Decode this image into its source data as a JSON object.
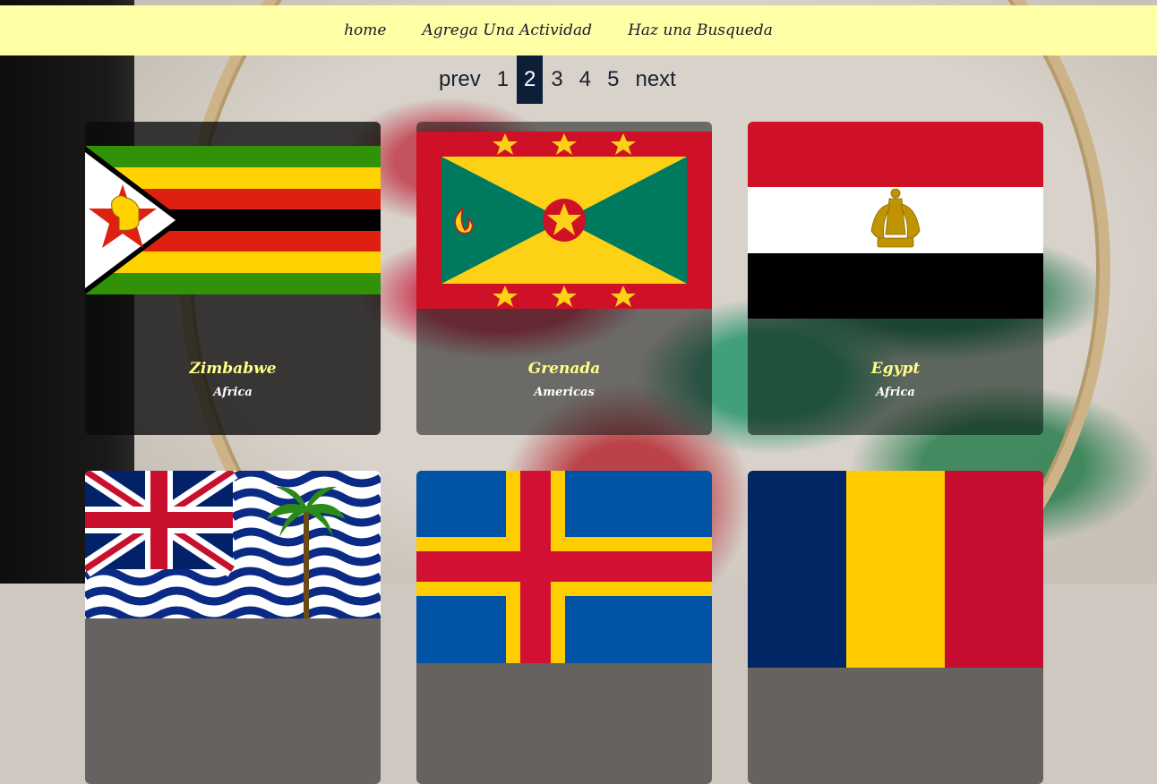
{
  "nav": {
    "links": [
      "home",
      "Agrega Una Actividad",
      "Haz una Busqueda"
    ]
  },
  "pagination": {
    "prev": "prev",
    "pages": [
      "1",
      "2",
      "3",
      "4",
      "5"
    ],
    "current": "2",
    "next": "next"
  },
  "cards": [
    {
      "country": "Zimbabwe",
      "region": "Africa",
      "flag_icon": "zimbabwe-flag"
    },
    {
      "country": "Grenada",
      "region": "Americas",
      "flag_icon": "grenada-flag"
    },
    {
      "country": "Egypt",
      "region": "Africa",
      "flag_icon": "egypt-flag"
    },
    {
      "flag_icon": "british-indian-ocean-territory-flag"
    },
    {
      "flag_icon": "aland-islands-flag"
    },
    {
      "flag_icon": "chad-flag"
    }
  ],
  "colors": {
    "navbar_bg": "#ffffa6",
    "active_page_bg": "#0c1e38",
    "country_text": "#ffff88"
  }
}
